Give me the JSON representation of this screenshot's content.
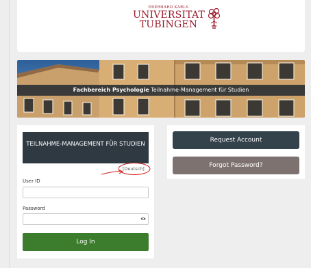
{
  "header": {
    "logo": {
      "line1": "EBERHARD KARLS",
      "line2": "UNIVERSITAT",
      "line3": "TUBINGEN",
      "icon": "palm-tree-emblem-icon"
    }
  },
  "banner": {
    "caption_bold": "Fachbereich Psychologie",
    "caption_rest": "Teilnahme-Management für Studien"
  },
  "login": {
    "title": "TEILNAHME-MANAGEMENT FÜR STUDIEN",
    "language": "[Deutsch]",
    "user_id_label": "User ID",
    "user_id_value": "",
    "password_label": "Password",
    "password_value": "",
    "login_button": "Log In"
  },
  "account": {
    "request_button": "Request Account",
    "forgot_button": "Forgot Password?"
  },
  "colors": {
    "brand_red": "#9c1b2c",
    "dark_panel": "#2f3942",
    "login_green": "#3b7d2c",
    "annotation_red": "#d42020"
  }
}
